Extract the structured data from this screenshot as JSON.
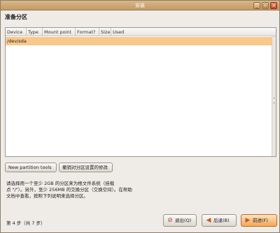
{
  "window": {
    "title": "安装"
  },
  "window_controls": {
    "minimize": "_",
    "maximize": "□",
    "close": "×"
  },
  "page": {
    "heading": "准备分区"
  },
  "table": {
    "columns": [
      "Device",
      "Type",
      "Mount point",
      "Format?",
      "Size",
      "Used"
    ],
    "rows": [
      {
        "device": "/dev/sda"
      }
    ]
  },
  "actions": {
    "new_partition_tools": "New partition tools",
    "undo_changes": "撤销对分区设置的修改"
  },
  "help_text": [
    "请选择用一个至少 2GB 的分区来为根文件系统（挂载",
    "点 \"/\"）。另外，至少 256MB 的交换分区（交换空间）。在帮助",
    "文档中查看，按照下列说明来选择分区。"
  ],
  "footer": {
    "step": "第 4 步（共 7 步）",
    "quit": "退出(Q)",
    "back": "后退(B)",
    "forward": "前进(F)"
  },
  "colors": {
    "accent": "#f9c88a",
    "titlebar": "#c39a63",
    "background": "#efebe7"
  }
}
